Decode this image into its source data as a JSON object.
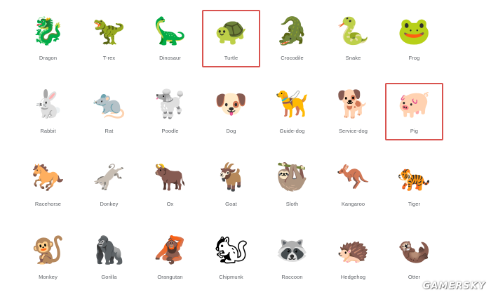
{
  "selection_color": "#d9534f",
  "label_color": "#5f6368",
  "emojis": [
    {
      "label": "Dragon",
      "icon": "dragon-icon",
      "glyph": "🐉",
      "selected": false
    },
    {
      "label": "T-rex",
      "icon": "t-rex-icon",
      "glyph": "🦖",
      "selected": false
    },
    {
      "label": "Dinosaur",
      "icon": "dinosaur-icon",
      "glyph": "🦕",
      "selected": false
    },
    {
      "label": "Turtle",
      "icon": "turtle-icon",
      "glyph": "🐢",
      "selected": true
    },
    {
      "label": "Crocodile",
      "icon": "crocodile-icon",
      "glyph": "🐊",
      "selected": false
    },
    {
      "label": "Snake",
      "icon": "snake-icon",
      "glyph": "🐍",
      "selected": false
    },
    {
      "label": "Frog",
      "icon": "frog-icon",
      "glyph": "🐸",
      "selected": false
    },
    {
      "label": "Rabbit",
      "icon": "rabbit-icon",
      "glyph": "🐇",
      "selected": false
    },
    {
      "label": "Rat",
      "icon": "rat-icon",
      "glyph": "🐀",
      "selected": false
    },
    {
      "label": "Poodle",
      "icon": "poodle-icon",
      "glyph": "🐩",
      "selected": false
    },
    {
      "label": "Dog",
      "icon": "dog-icon",
      "glyph": "🐶",
      "selected": false
    },
    {
      "label": "Guide-dog",
      "icon": "guide-dog-icon",
      "glyph": "🦮",
      "selected": false
    },
    {
      "label": "Service-dog",
      "icon": "service-dog-icon",
      "glyph": "🐕",
      "selected": false
    },
    {
      "label": "Pig",
      "icon": "pig-icon",
      "glyph": "🐖",
      "selected": true
    },
    {
      "label": "Racehorse",
      "icon": "racehorse-icon",
      "glyph": "🐎",
      "selected": false
    },
    {
      "label": "Donkey",
      "icon": "donkey-icon",
      "glyph": "🫏",
      "selected": false
    },
    {
      "label": "Ox",
      "icon": "ox-icon",
      "glyph": "🐂",
      "selected": false
    },
    {
      "label": "Goat",
      "icon": "goat-icon",
      "glyph": "🐐",
      "selected": false
    },
    {
      "label": "Sloth",
      "icon": "sloth-icon",
      "glyph": "🦥",
      "selected": false
    },
    {
      "label": "Kangaroo",
      "icon": "kangaroo-icon",
      "glyph": "🦘",
      "selected": false
    },
    {
      "label": "Tiger",
      "icon": "tiger-icon",
      "glyph": "🐅",
      "selected": false
    },
    {
      "label": "Monkey",
      "icon": "monkey-icon",
      "glyph": "🐒",
      "selected": false
    },
    {
      "label": "Gorilla",
      "icon": "gorilla-icon",
      "glyph": "🦍",
      "selected": false
    },
    {
      "label": "Orangutan",
      "icon": "orangutan-icon",
      "glyph": "🦧",
      "selected": false
    },
    {
      "label": "Chipmunk",
      "icon": "chipmunk-icon",
      "glyph": "🐿",
      "selected": false
    },
    {
      "label": "Raccoon",
      "icon": "raccoon-icon",
      "glyph": "🦝",
      "selected": false
    },
    {
      "label": "Hedgehog",
      "icon": "hedgehog-icon",
      "glyph": "🦔",
      "selected": false
    },
    {
      "label": "Otter",
      "icon": "otter-icon",
      "glyph": "🦦",
      "selected": false
    }
  ],
  "watermark": "GAMERSKY"
}
